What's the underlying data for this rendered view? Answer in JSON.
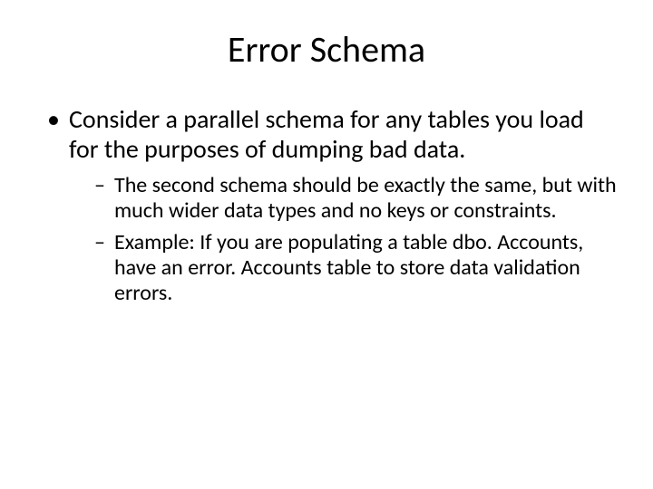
{
  "title": "Error Schema",
  "bullets": [
    {
      "text": "Consider a parallel schema for any tables you load for the purposes of dumping bad data.",
      "children": [
        "The second schema should be exactly the same, but with much wider data types and no keys or constraints.",
        "Example: If you are populating a table dbo. Accounts, have an error. Accounts table to store data validation errors."
      ]
    }
  ]
}
